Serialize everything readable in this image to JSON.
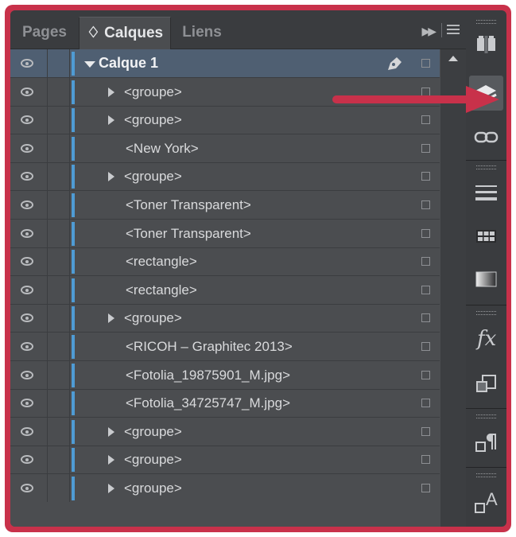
{
  "tabs": [
    {
      "label": "Pages",
      "active": false
    },
    {
      "label": "♢ Calques",
      "active": true
    },
    {
      "label": "Liens",
      "active": false
    }
  ],
  "panel_menu_icon": "panel-menu-icon",
  "forward_icon": "double-chevron-icon",
  "layers": [
    {
      "label": "Calque 1",
      "type": "layer",
      "expanded": true
    },
    {
      "label": "<groupe>",
      "type": "group"
    },
    {
      "label": "<groupe>",
      "type": "group"
    },
    {
      "label": "<New York>",
      "type": "item"
    },
    {
      "label": "<groupe>",
      "type": "group"
    },
    {
      "label": "<Toner Transparent>",
      "type": "item"
    },
    {
      "label": "<Toner Transparent>",
      "type": "item"
    },
    {
      "label": "<rectangle>",
      "type": "item"
    },
    {
      "label": "<rectangle>",
      "type": "item"
    },
    {
      "label": "<groupe>",
      "type": "group"
    },
    {
      "label": "<RICOH – Graphitec 2013>",
      "type": "item"
    },
    {
      "label": "<Fotolia_19875901_M.jpg>",
      "type": "item"
    },
    {
      "label": "<Fotolia_34725747_M.jpg>",
      "type": "item"
    },
    {
      "label": "<groupe>",
      "type": "group"
    },
    {
      "label": "<groupe>",
      "type": "group"
    },
    {
      "label": "<groupe>",
      "type": "group"
    }
  ],
  "sidebar": {
    "icons": [
      "pages-icon",
      "layers-icon",
      "links-icon",
      "stroke-icon",
      "swatches-icon",
      "gradient-icon",
      "effects-icon",
      "text-wrap-icon",
      "paragraph-styles-icon",
      "character-styles-icon"
    ],
    "fx_label": "fx",
    "char_label": "A"
  },
  "colors": {
    "layer_color": "#4f9bd4",
    "frame_accent": "#c8314a",
    "panel_bg": "#4b4d50",
    "selected_row": "#4f5f72"
  }
}
